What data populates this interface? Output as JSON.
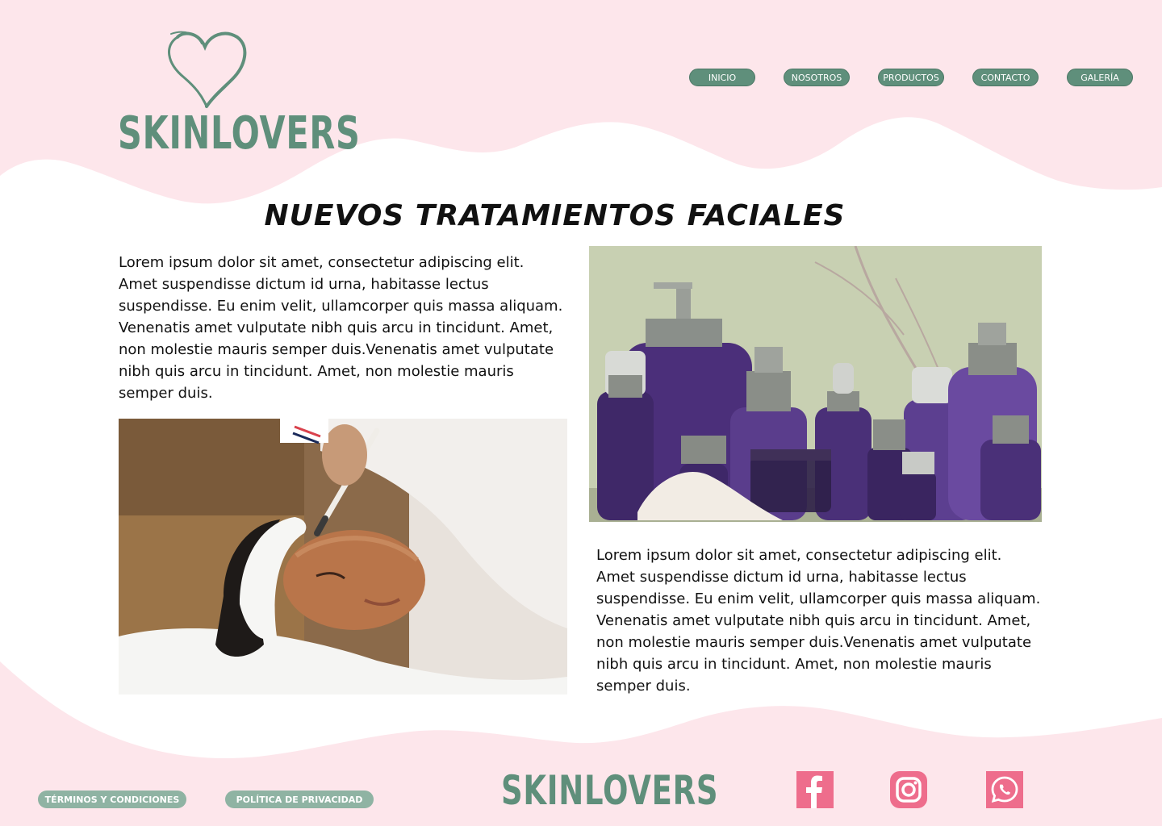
{
  "brand": {
    "logo_text": "SKINLOVERS",
    "primary_color": "#5f8f7b",
    "pink_color": "#fde6eb",
    "icon_color": "#ee6d8c"
  },
  "nav": {
    "items": [
      {
        "label": "INICIO"
      },
      {
        "label": "NOSOTROS"
      },
      {
        "label": "PRODUCTOS"
      },
      {
        "label": "CONTACTO"
      },
      {
        "label": "GALERÍA"
      }
    ]
  },
  "main": {
    "title": "NUEVOS TRATAMIENTOS FACIALES",
    "paragraph_1": "Lorem ipsum dolor sit amet, consectetur adipiscing elit. Amet suspendisse dictum id urna, habitasse lectus suspendisse. Eu enim velit, ullamcorper quis massa aliquam. Venenatis amet vulputate nibh quis arcu in tincidunt. Amet, non molestie mauris semper duis.Venenatis amet vulputate nibh quis arcu in tincidunt. Amet, non molestie mauris semper duis.",
    "paragraph_2": "Lorem ipsum dolor sit amet, consectetur adipiscing elit. Amet suspendisse dictum id urna, habitasse lectus suspendisse. Eu enim velit, ullamcorper quis massa aliquam. Venenatis amet vulputate nibh quis arcu in tincidunt. Amet, non molestie mauris semper duis.Venenatis amet vulputate nibh quis arcu in tincidunt. Amet, non molestie mauris semper duis."
  },
  "footer": {
    "terms_label": "TÉRMINOS Y CONDICIONES",
    "privacy_label": "POLÍTICA DE PRIVACIDAD",
    "logo_text": "SKINLOVERS",
    "social_icons": [
      "facebook-icon",
      "instagram-icon",
      "whatsapp-icon"
    ]
  }
}
